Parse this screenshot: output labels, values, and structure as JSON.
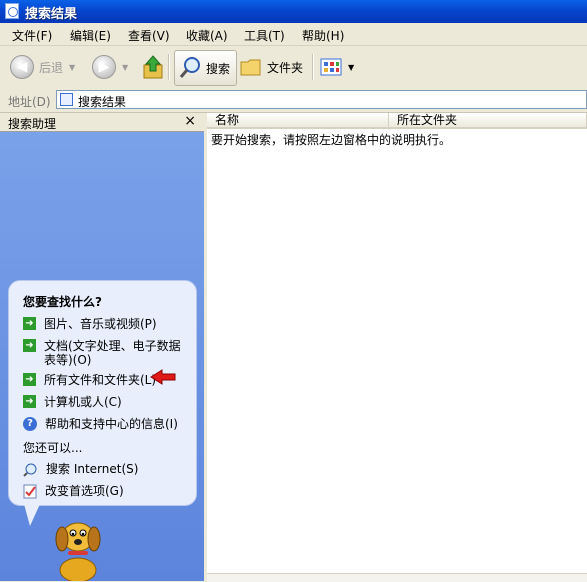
{
  "window": {
    "title": "搜索结果"
  },
  "menu": [
    "文件(F)",
    "编辑(E)",
    "查看(V)",
    "收藏(A)",
    "工具(T)",
    "帮助(H)"
  ],
  "toolbar": {
    "back_label": "后退",
    "search_label": "搜索",
    "folders_label": "文件夹"
  },
  "address": {
    "label": "地址(D)",
    "value": "搜索结果"
  },
  "assistant": {
    "header": "搜索助理",
    "close": "×",
    "question": "您要查找什么?",
    "options": [
      "图片、音乐或视频(P)",
      "文档(文字处理、电子数据表等)(O)",
      "所有文件和文件夹(L)",
      "计算机或人(C)",
      "帮助和支持中心的信息(I)"
    ],
    "also": "您还可以...",
    "extra": [
      "搜索 Internet(S)",
      "改变首选项(G)"
    ]
  },
  "results": {
    "columns": [
      "名称",
      "所在文件夹"
    ],
    "instruction": "要开始搜索，请按照左边窗格中的说明执行。"
  }
}
